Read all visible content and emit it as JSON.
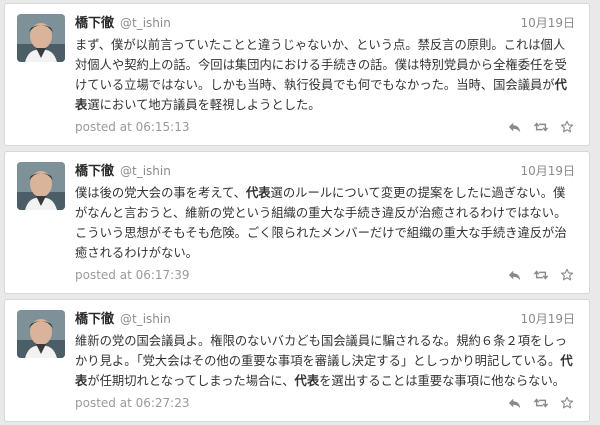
{
  "tweets": [
    {
      "name": "橋下徹",
      "handle": "@t_ishin",
      "date": "10月19日",
      "text_parts": [
        {
          "text": "まず、僕が以前言っていたことと違うじゃないか、という点。禁反言の原則。これは個人対個人や契約上の話。今回は集団内における手続きの話。僕は特別党員から全権委任を受けている立場ではない。しかも当時、執行役員でも何でもなかった。当時、国会議員が",
          "bold": false
        },
        {
          "text": "代表",
          "bold": true
        },
        {
          "text": "選において地方議員を軽視しようとした。",
          "bold": false
        }
      ],
      "posted": "posted at 06:15:13"
    },
    {
      "name": "橋下徹",
      "handle": "@t_ishin",
      "date": "10月19日",
      "text_parts": [
        {
          "text": "僕は後の党大会の事を考えて、",
          "bold": false
        },
        {
          "text": "代表",
          "bold": true
        },
        {
          "text": "選のルールについて変更の提案をしたに過ぎない。僕がなんと言おうと、維新の党という組織の重大な手続き違反が治癒されるわけではない。こういう思想がそもそも危険。ごく限られたメンバーだけで組織の重大な手続き違反が治癒されるわけがない。",
          "bold": false
        }
      ],
      "posted": "posted at 06:17:39"
    },
    {
      "name": "橋下徹",
      "handle": "@t_ishin",
      "date": "10月19日",
      "text_parts": [
        {
          "text": "維新の党の国会議員よ。権限のないバカども国会議員に騙されるな。規約６条２項をしっかり見よ。「党大会はその他の重要な事項を審議し決定する」としっかり明記している。",
          "bold": false
        },
        {
          "text": "代表",
          "bold": true
        },
        {
          "text": "が任期切れとなってしまった場合に、",
          "bold": false
        },
        {
          "text": "代表",
          "bold": true
        },
        {
          "text": "を選出することは重要な事項に他ならない。",
          "bold": false
        }
      ],
      "posted": "posted at 06:27:23"
    }
  ],
  "icons": {
    "reply": "reply-icon",
    "retweet": "retweet-icon",
    "favorite": "star-icon"
  },
  "colors": {
    "background": "#e9e9e9",
    "card": "#ffffff",
    "muted_text": "#8b8b8b",
    "icon": "#8a8a8a"
  }
}
